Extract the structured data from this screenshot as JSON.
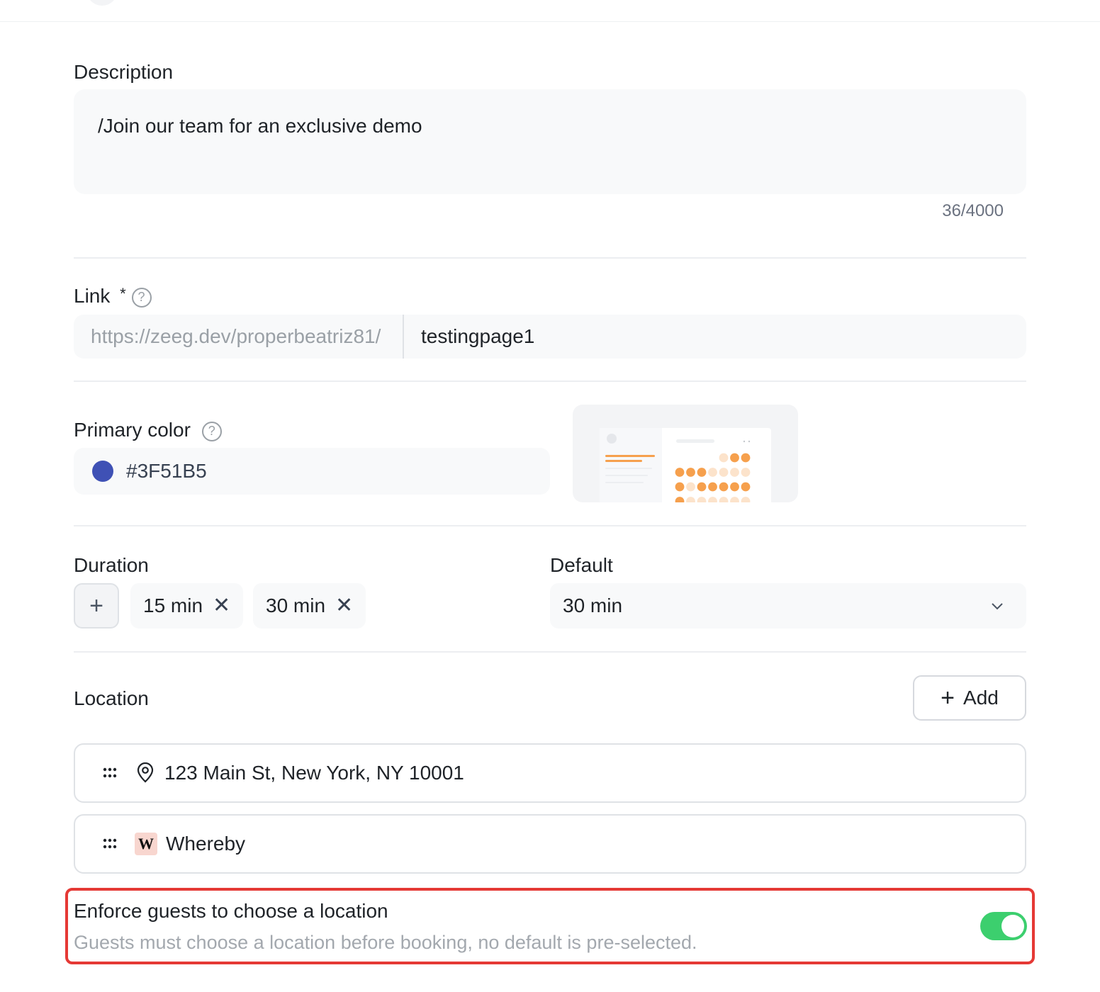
{
  "description": {
    "label": "Description",
    "value": "/Join our team for an exclusive demo",
    "counter": "36/4000"
  },
  "link": {
    "label": "Link",
    "required_mark": "*",
    "help": "?",
    "prefix": "https://zeeg.dev/properbeatriz81/",
    "slug": "testingpage1"
  },
  "primary_color": {
    "label": "Primary color",
    "help": "?",
    "value": "#3F51B5"
  },
  "duration": {
    "label": "Duration",
    "add_symbol": "+",
    "chips": [
      {
        "label": "15 min",
        "remove": "✕"
      },
      {
        "label": "30 min",
        "remove": "✕"
      }
    ]
  },
  "default": {
    "label": "Default",
    "value": "30 min"
  },
  "location": {
    "label": "Location",
    "add_label": "Add",
    "add_symbol": "+",
    "items": [
      {
        "label": "123 Main St, New York, NY 10001",
        "icon": "map-pin-icon"
      },
      {
        "label": "Whereby",
        "icon": "whereby-logo",
        "logo_letter": "W"
      }
    ]
  },
  "enforce": {
    "title": "Enforce guests to choose a location",
    "subtitle": "Guests must choose a location before booking, no default is pre-selected.",
    "enabled": true
  },
  "colors": {
    "accent_toggle": "#3ccf6e",
    "swatch": "#3F51B5",
    "highlight": "#e53935",
    "preview_orange": "#f6a04d",
    "preview_orange_light": "#fce3cb"
  }
}
